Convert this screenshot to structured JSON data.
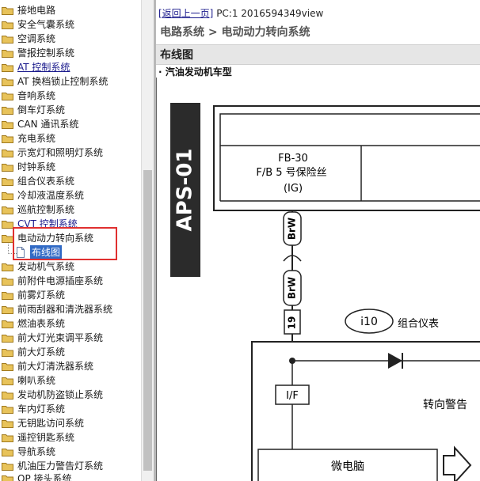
{
  "tree": {
    "items": [
      {
        "label": "接地电路"
      },
      {
        "label": "安全气囊系统"
      },
      {
        "label": "空调系统"
      },
      {
        "label": "警报控制系统"
      },
      {
        "label": "AT 控制系统"
      },
      {
        "label": "AT 换档锁止控制系统"
      },
      {
        "label": "音响系统"
      },
      {
        "label": "倒车灯系统"
      },
      {
        "label": "CAN 通讯系统"
      },
      {
        "label": "充电系统"
      },
      {
        "label": "示宽灯和照明灯系统"
      },
      {
        "label": "时钟系统"
      },
      {
        "label": "组合仪表系统"
      },
      {
        "label": "冷却液温度系统"
      },
      {
        "label": "巡航控制系统"
      },
      {
        "label": "CVT 控制系统"
      },
      {
        "label": "电动动力转向系统"
      },
      {
        "label": "布线图"
      },
      {
        "label": "发动机气系统"
      },
      {
        "label": "前附件电源插座系统"
      },
      {
        "label": "前雾灯系统"
      },
      {
        "label": "前雨刮器和清洗器系统"
      },
      {
        "label": "燃油表系统"
      },
      {
        "label": "前大灯光束调平系统"
      },
      {
        "label": "前大灯系统"
      },
      {
        "label": "前大灯清洗器系统"
      },
      {
        "label": "喇叭系统"
      },
      {
        "label": "发动机防盗锁止系统"
      },
      {
        "label": "车内灯系统"
      },
      {
        "label": "无钥匙访问系统"
      },
      {
        "label": "遥控钥匙系统"
      },
      {
        "label": "导航系统"
      },
      {
        "label": "机油压力警告灯系统"
      },
      {
        "label": "OP 接头系统"
      }
    ]
  },
  "content": {
    "back_link": "[返回上一页]",
    "page_info": " PC:1 2016594349view",
    "title": "电路系统 > 电动动力转向系统",
    "section": "布线图",
    "variant": "· 汽油发动机车型"
  },
  "diagram": {
    "sheet_id": "APS-01",
    "fuse_line1": "FB-30",
    "fuse_line2": "F/B 5 号保险丝",
    "fuse_line3": "(IG)",
    "wire1": "BrW",
    "wire2": "BrW",
    "pin": "19",
    "connector": "i10",
    "module_name": "组合仪表",
    "interface": "I/F",
    "warning_label": "转向警告",
    "micro": "微电脑"
  },
  "colors": {
    "highlight_border": "#e03030",
    "selected_bg": "#316ac5",
    "folder_yellow": "#e8c35a",
    "section_bg": "#e6e6e6"
  }
}
